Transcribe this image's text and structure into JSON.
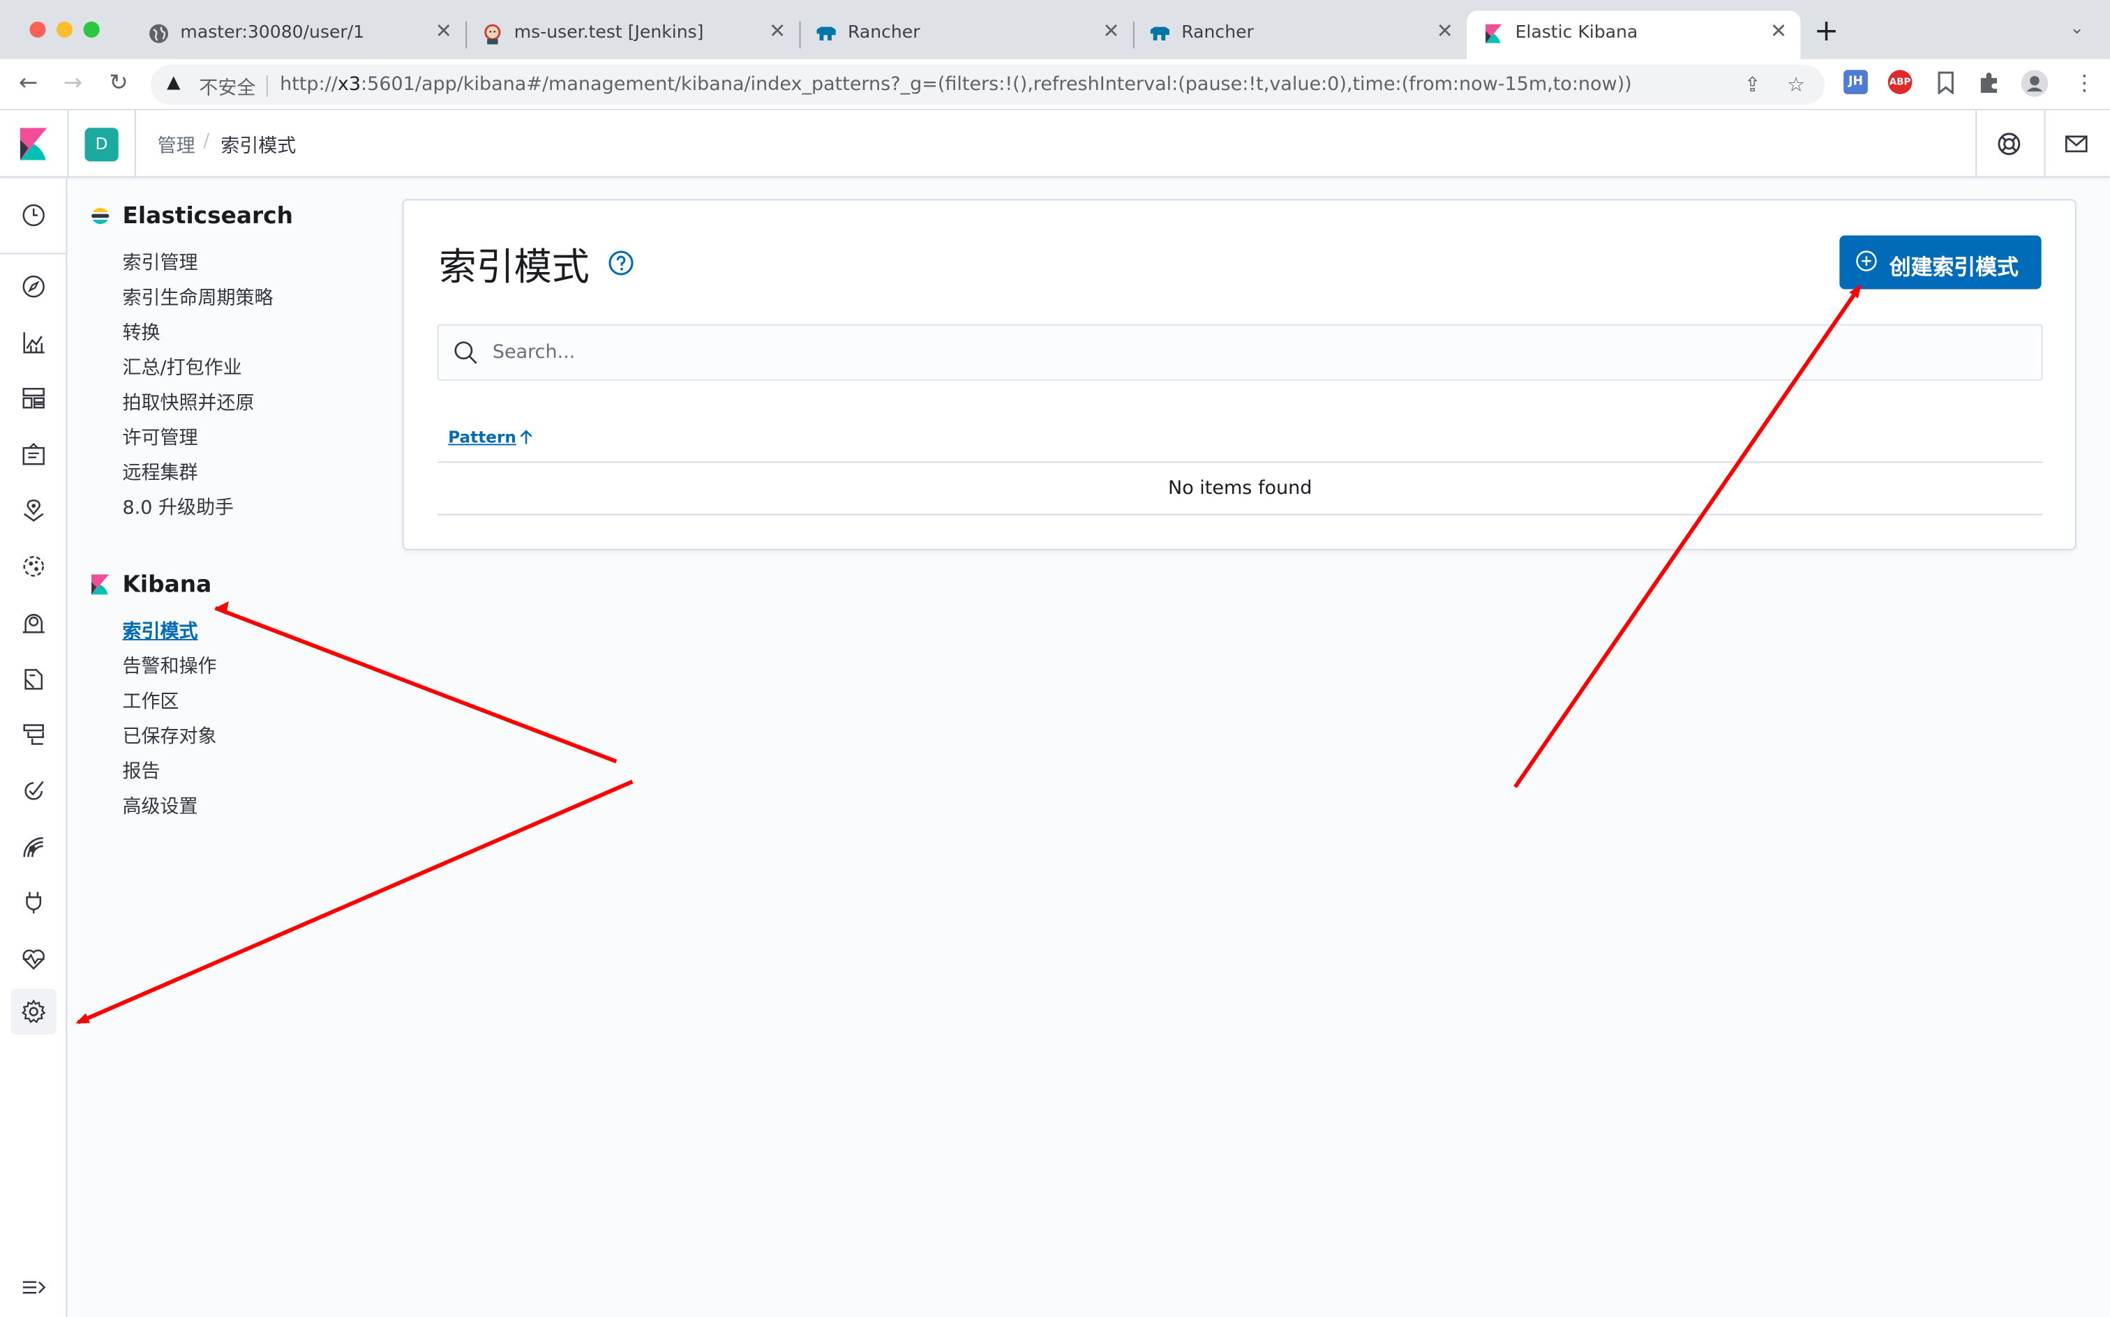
{
  "browser": {
    "tabs": [
      {
        "title": "master:30080/user/1",
        "icon": "globe-icon",
        "active": false
      },
      {
        "title": "ms-user.test [Jenkins]",
        "icon": "jenkins-icon",
        "active": false
      },
      {
        "title": "Rancher",
        "icon": "rancher-icon",
        "active": false
      },
      {
        "title": "Rancher",
        "icon": "rancher-icon",
        "active": false
      },
      {
        "title": "Elastic Kibana",
        "icon": "kibana-icon",
        "active": true
      }
    ],
    "insecure_label": "不安全",
    "url_prefix": "http://",
    "url_host": "x3",
    "url_rest": ":5601/app/kibana#/management/kibana/index_patterns?_g=(filters:!(),refreshInterval:(pause:!t,value:0),time:(from:now-15m,to:now))",
    "extensions": {
      "jh": "JH",
      "abp": "ABP"
    }
  },
  "header": {
    "space_initial": "D",
    "breadcrumbs": [
      "管理",
      "索引模式"
    ]
  },
  "sidebar": {
    "elasticsearch": {
      "title": "Elasticsearch",
      "items": [
        "索引管理",
        "索引生命周期策略",
        "转换",
        "汇总/打包作业",
        "拍取快照并还原",
        "许可管理",
        "远程集群",
        "8.0 升级助手"
      ]
    },
    "kibana": {
      "title": "Kibana",
      "items": [
        "索引模式",
        "告警和操作",
        "工作区",
        "已保存对象",
        "报告",
        "高级设置"
      ],
      "active": "索引模式"
    }
  },
  "main": {
    "title": "索引模式",
    "create_button": "创建索引模式",
    "search_placeholder": "Search...",
    "column_header": "Pattern",
    "empty_message": "No items found"
  },
  "colors": {
    "accent": "#006bb8",
    "annotation": "#ff0000",
    "space_badge": "#1ba9a0"
  }
}
